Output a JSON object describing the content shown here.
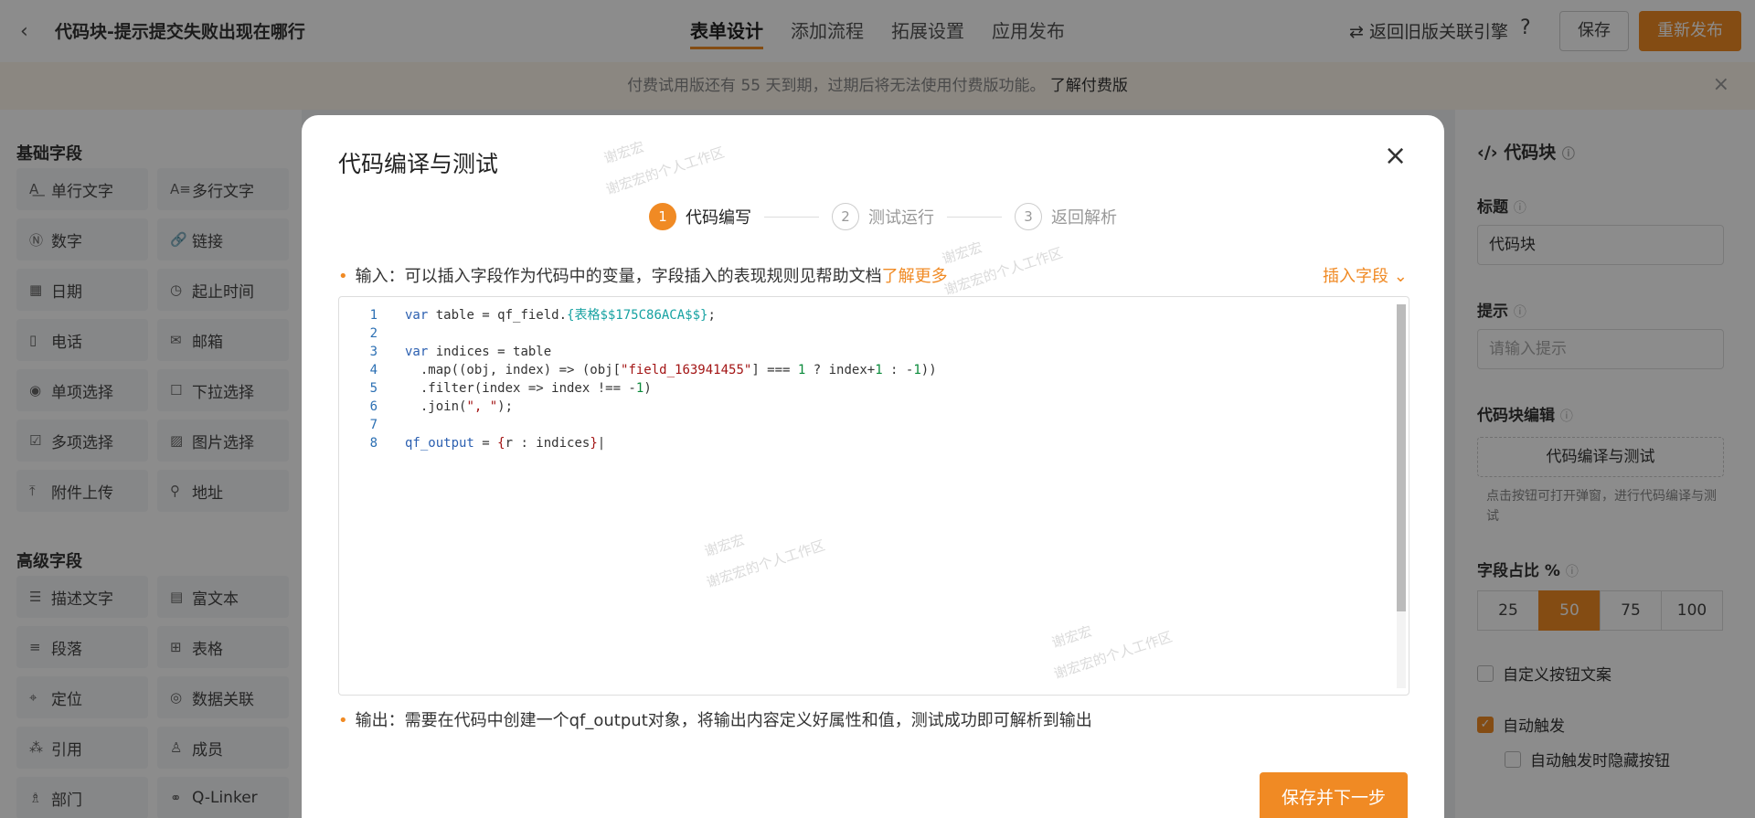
{
  "header": {
    "title": "代码块-提示提交失败出现在哪行",
    "tabs": [
      "表单设计",
      "添加流程",
      "拓展设置",
      "应用发布"
    ],
    "revert_label": "返回旧版关联引擎",
    "help_label": "?",
    "save_label": "保存",
    "republish_label": "重新发布"
  },
  "trial": {
    "text": "付费试用版还有 55 天到期，过期后将无法使用付费版功能。",
    "link": "了解付费版"
  },
  "left": {
    "basic_title": "基础字段",
    "basic_fields": [
      "单行文字",
      "多行文字",
      "数字",
      "链接",
      "日期",
      "起止时间",
      "电话",
      "邮箱",
      "单项选择",
      "下拉选择",
      "多项选择",
      "图片选择",
      "附件上传",
      "地址"
    ],
    "advanced_title": "高级字段",
    "advanced_fields": [
      "描述文字",
      "富文本",
      "段落",
      "表格",
      "定位",
      "数据关联",
      "引用",
      "成员",
      "部门",
      "Q-Linker"
    ]
  },
  "right": {
    "head": "代码块",
    "title_label": "标题",
    "title_value": "代码块",
    "hint_label": "提示",
    "hint_placeholder": "请输入提示",
    "edit_label": "代码块编辑",
    "edit_button": "代码编译与测试",
    "edit_hint": "点击按钮可打开弹窗，进行代码编译与测试",
    "ratio_label": "字段占比 %",
    "ratio_options": [
      "25",
      "50",
      "75",
      "100"
    ],
    "custom_btn_label": "自定义按钮文案",
    "auto_trigger_label": "自动触发",
    "auto_hide_label": "自动触发时隐藏按钮"
  },
  "modal": {
    "title": "代码编译与测试",
    "close": "×",
    "steps": [
      {
        "num": "1",
        "label": "代码编写"
      },
      {
        "num": "2",
        "label": "测试运行"
      },
      {
        "num": "3",
        "label": "返回解析"
      }
    ],
    "input_text": "输入：可以插入字段作为代码中的变量，字段插入的表现规则见帮助文档",
    "learn_more": "了解更多",
    "insert_field": "插入字段",
    "code_line_numbers": [
      "1",
      "2",
      "3",
      "4",
      "5",
      "6",
      "7",
      "8"
    ],
    "output_text": "输出：需要在代码中创建一个qf_output对象，将输出内容定义好属性和值，测试成功即可解析到输出",
    "next_button": "保存并下一步"
  },
  "watermark": [
    "谢宏宏",
    "谢宏宏的个人工作区"
  ]
}
